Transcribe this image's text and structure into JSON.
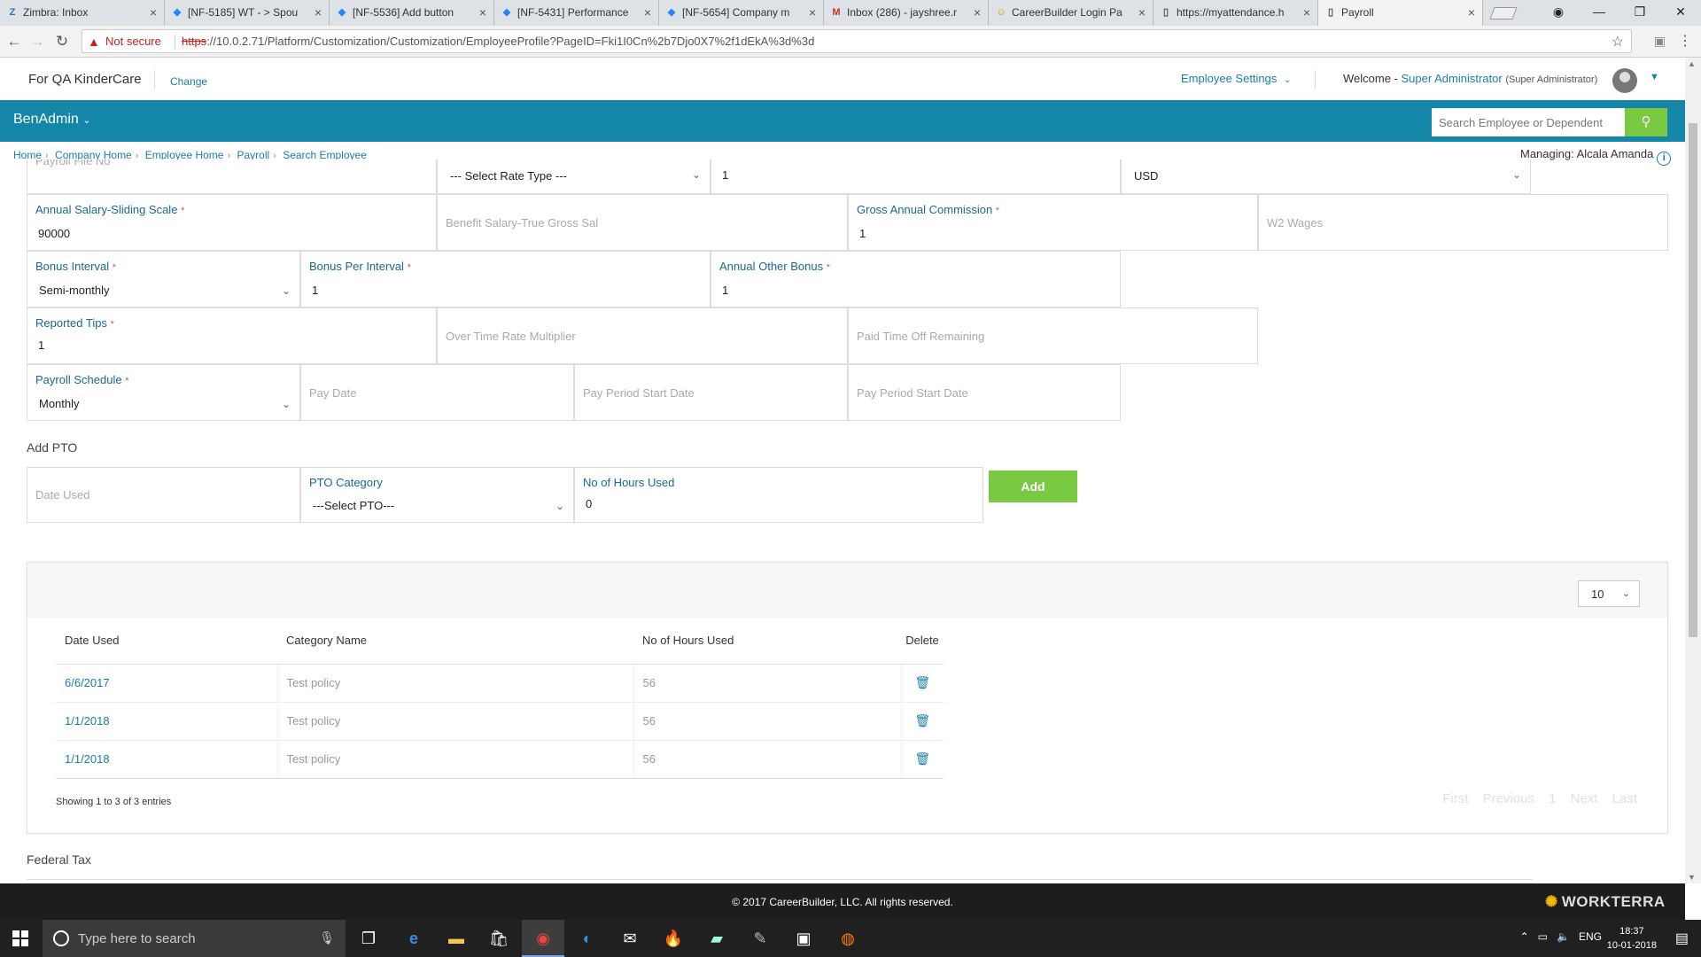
{
  "browser": {
    "tabs": [
      {
        "label": "Zimbra: Inbox",
        "icon": "Z",
        "color": "#2b6fb6"
      },
      {
        "label": "[NF-5185] WT - > Spou",
        "icon": "◆",
        "color": "#2684ff"
      },
      {
        "label": "[NF-5536] Add button",
        "icon": "◆",
        "color": "#2684ff"
      },
      {
        "label": "[NF-5431] Performance",
        "icon": "◆",
        "color": "#2684ff"
      },
      {
        "label": "[NF-5654] Company m",
        "icon": "◆",
        "color": "#2684ff"
      },
      {
        "label": "Inbox (286) - jayshree.r",
        "icon": "M",
        "color": "#d93025"
      },
      {
        "label": "CareerBuilder Login Pa",
        "icon": "☺",
        "color": "#c2a100"
      },
      {
        "label": "https://myattendance.h",
        "icon": "▯",
        "color": "#555555"
      },
      {
        "label": "Payroll",
        "icon": "▯",
        "color": "#555555"
      }
    ],
    "security_label": "Not secure",
    "url_scheme": "https",
    "url_rest": "://10.0.2.71/Platform/Customization/Customization/EmployeeProfile?PageID=Fki1I0Cn%2b7Djo0X7%2f1dEkA%3d%3d"
  },
  "header": {
    "company": "For QA KinderCare",
    "change": "Change",
    "employee_settings": "Employee Settings",
    "welcome": "Welcome -",
    "user_name": "Super Administrator",
    "user_role": "(Super Administrator)"
  },
  "navbar": {
    "brand": "BenAdmin",
    "search_placeholder": "Search Employee or Dependent"
  },
  "breadcrumb": [
    "Home",
    "Company Home",
    "Employee Home",
    "Payroll",
    "Search Employee"
  ],
  "managing": "Managing: Alcala Amanda",
  "form": {
    "payroll_file_no_label": "Payroll File No",
    "rate_type": "--- Select Rate Type ---",
    "rate_value": "1",
    "currency": "USD",
    "annual_salary_label": "Annual Salary-Sliding Scale",
    "annual_salary_value": "90000",
    "benefit_salary_ph": "Benefit Salary-True Gross Sal",
    "gross_commission_label": "Gross Annual Commission",
    "gross_commission_value": "1",
    "w2_wages_ph": "W2 Wages",
    "bonus_interval_label": "Bonus Interval",
    "bonus_interval_value": "Semi-monthly",
    "bonus_per_interval_label": "Bonus Per Interval",
    "bonus_per_interval_value": "1",
    "annual_other_bonus_label": "Annual Other Bonus",
    "annual_other_bonus_value": "1",
    "reported_tips_label": "Reported Tips",
    "reported_tips_value": "1",
    "overtime_ph": "Over Time Rate Multiplier",
    "pto_remaining_ph": "Paid Time Off Remaining",
    "payroll_schedule_label": "Payroll Schedule",
    "payroll_schedule_value": "Monthly",
    "pay_date_ph": "Pay Date",
    "pay_period_start_ph": "Pay Period Start Date",
    "pay_period_start2_ph": "Pay Period Start Date",
    "required_mark": "*"
  },
  "add_pto": {
    "title": "Add PTO",
    "date_used_ph": "Date Used",
    "category_label": "PTO Category",
    "category_value": "---Select PTO---",
    "hours_label": "No of Hours Used",
    "hours_value": "0",
    "add_button": "Add"
  },
  "pto_table": {
    "page_size": "10",
    "columns": [
      "Date Used",
      "Category Name",
      "No of Hours Used",
      "Delete"
    ],
    "rows": [
      {
        "date": "6/6/2017",
        "category": "Test policy",
        "hours": "56"
      },
      {
        "date": "1/1/2018",
        "category": "Test policy",
        "hours": "56"
      },
      {
        "date": "1/1/2018",
        "category": "Test policy",
        "hours": "56"
      }
    ],
    "showing": "Showing 1 to 3 of 3 entries",
    "pager": [
      "First",
      "Previous",
      "1",
      "Next",
      "Last"
    ]
  },
  "federal_tax": "Federal Tax",
  "footer": {
    "copyright": "© 2017 CareerBuilder, LLC. All rights reserved.",
    "logo": "WORKTERRA"
  },
  "taskbar": {
    "search_placeholder": "Type here to search",
    "language": "ENG",
    "time": "18:37",
    "date": "10-01-2018"
  }
}
